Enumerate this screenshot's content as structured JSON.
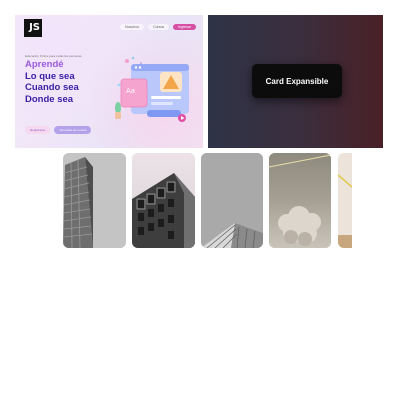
{
  "hero": {
    "logo_text": "JS",
    "nav_links": [
      "Nosotros",
      "Cursos"
    ],
    "nav_cta": "Ingresar",
    "eyebrow": "Educación Online para todas las personas",
    "headline": [
      "Aprendé",
      "Lo que sea",
      "Cuando sea",
      "Donde sea"
    ],
    "primary_button": "Registrarse",
    "secondary_button": "Ver todos los cursos",
    "illustration_card_text": "Aa",
    "colors": {
      "headline_light": "#9a5ae0",
      "headline_dark": "#3a21a8",
      "cta_pink": "#d64fa5"
    }
  },
  "card_panel": {
    "card_label": "Card Expansible",
    "background_gradient": [
      "#2e3346",
      "#3a2f3f",
      "#4a2026"
    ]
  },
  "photos": [
    {
      "subject": "skyscraper-facade"
    },
    {
      "subject": "modern-building"
    },
    {
      "subject": "building-corner"
    },
    {
      "subject": "clouds-and-wire"
    },
    {
      "subject": "partial-photo"
    }
  ]
}
